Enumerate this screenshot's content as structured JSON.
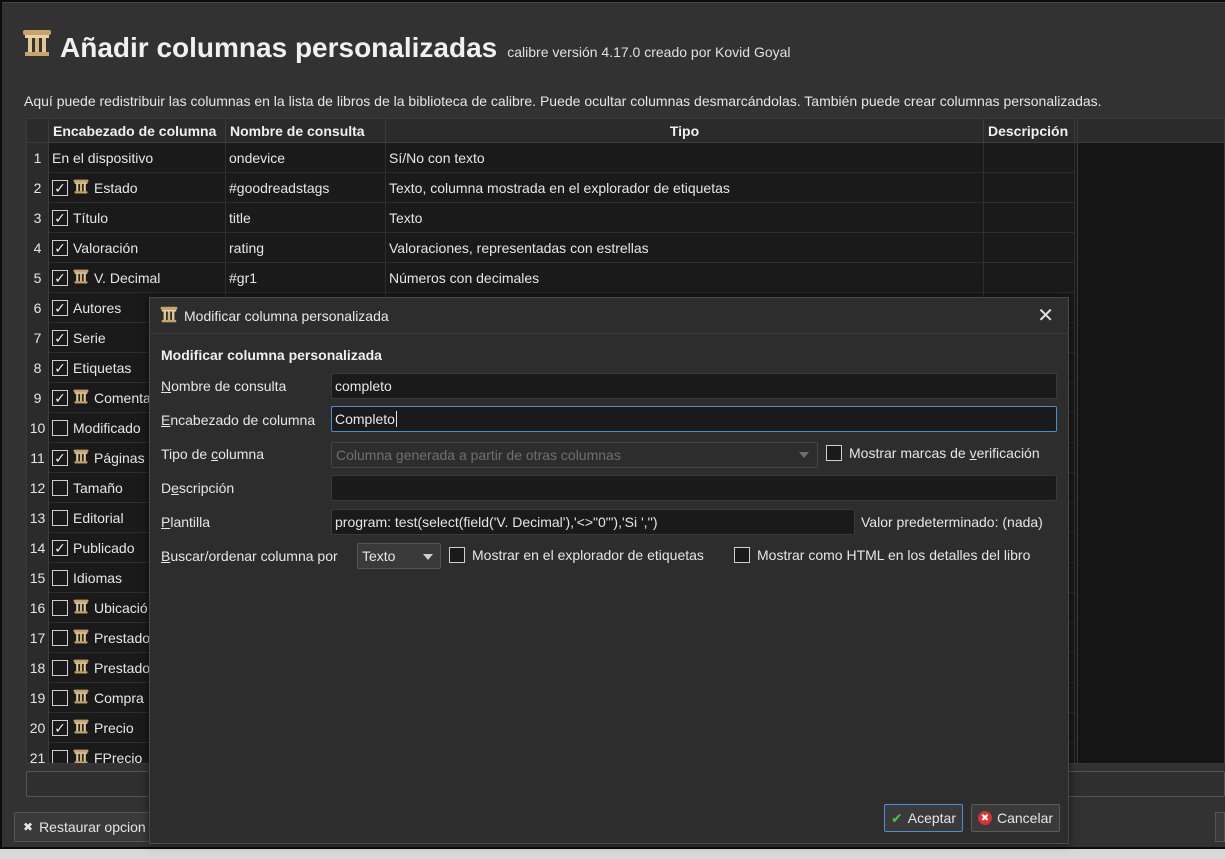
{
  "header": {
    "title": "Añadir columnas personalizadas",
    "subtitle": "calibre versión 4.17.0 creado por Kovid Goyal"
  },
  "description": "Aquí puede redistribuir las columnas en la lista de libros de la biblioteca de calibre. Puede ocultar columnas desmarcándolas. También puede crear columnas personalizadas.",
  "table": {
    "columns": [
      "Encabezado de columna",
      "Nombre de consulta",
      "Tipo",
      "Descripción"
    ],
    "rows": [
      {
        "num": "1",
        "checkbox": "none",
        "custom": false,
        "header": "En el dispositivo",
        "lookup": "ondevice",
        "type": "Sí/No con texto"
      },
      {
        "num": "2",
        "checkbox": "checked",
        "custom": true,
        "header": "Estado",
        "lookup": "#goodreadstags",
        "type": "Texto, columna mostrada en el explorador de etiquetas"
      },
      {
        "num": "3",
        "checkbox": "checked",
        "custom": false,
        "header": "Título",
        "lookup": "title",
        "type": "Texto"
      },
      {
        "num": "4",
        "checkbox": "checked",
        "custom": false,
        "header": "Valoración",
        "lookup": "rating",
        "type": "Valoraciones, representadas con estrellas"
      },
      {
        "num": "5",
        "checkbox": "checked",
        "custom": true,
        "header": "V. Decimal",
        "lookup": "#gr1",
        "type": "Números con decimales"
      },
      {
        "num": "6",
        "checkbox": "checked",
        "custom": false,
        "header": "Autores",
        "lookup": "",
        "type": ""
      },
      {
        "num": "7",
        "checkbox": "checked",
        "custom": false,
        "header": "Serie",
        "lookup": "",
        "type": ""
      },
      {
        "num": "8",
        "checkbox": "checked",
        "custom": false,
        "header": "Etiquetas",
        "lookup": "",
        "type": ""
      },
      {
        "num": "9",
        "checkbox": "checked",
        "custom": true,
        "header": "Comenta",
        "lookup": "",
        "type": ""
      },
      {
        "num": "10",
        "checkbox": "unchecked",
        "custom": false,
        "header": "Modificado",
        "lookup": "",
        "type": ""
      },
      {
        "num": "11",
        "checkbox": "checked",
        "custom": true,
        "header": "Páginas",
        "lookup": "",
        "type": ""
      },
      {
        "num": "12",
        "checkbox": "unchecked",
        "custom": false,
        "header": "Tamaño",
        "lookup": "",
        "type": ""
      },
      {
        "num": "13",
        "checkbox": "unchecked",
        "custom": false,
        "header": "Editorial",
        "lookup": "",
        "type": ""
      },
      {
        "num": "14",
        "checkbox": "checked",
        "custom": false,
        "header": "Publicado",
        "lookup": "",
        "type": ""
      },
      {
        "num": "15",
        "checkbox": "unchecked",
        "custom": false,
        "header": "Idiomas",
        "lookup": "",
        "type": ""
      },
      {
        "num": "16",
        "checkbox": "unchecked",
        "custom": true,
        "header": "Ubicació",
        "lookup": "",
        "type": ""
      },
      {
        "num": "17",
        "checkbox": "unchecked",
        "custom": true,
        "header": "Prestado",
        "lookup": "",
        "type": ""
      },
      {
        "num": "18",
        "checkbox": "unchecked",
        "custom": true,
        "header": "Prestado",
        "lookup": "",
        "type": ""
      },
      {
        "num": "19",
        "checkbox": "unchecked",
        "custom": true,
        "header": "Compra",
        "lookup": "",
        "type": ""
      },
      {
        "num": "20",
        "checkbox": "checked",
        "custom": true,
        "header": "Precio",
        "lookup": "",
        "type": ""
      },
      {
        "num": "21",
        "checkbox": "unchecked",
        "custom": true,
        "header": "FPrecio",
        "lookup": "",
        "type": ""
      }
    ]
  },
  "restore_button": "Restaurar opcion",
  "dialog": {
    "title": "Modificar columna personalizada",
    "heading": "Modificar columna personalizada",
    "lookup_label_prefix": "N",
    "lookup_label_rest": "ombre de consulta",
    "lookup_value": "completo",
    "header_label_prefix": "E",
    "header_label_rest": "ncabezado de columna",
    "header_value": "Completo",
    "type_label_a": "Tipo de ",
    "type_label_u": "c",
    "type_label_b": "olumna",
    "type_value": "Columna generada a partir de otras columnas",
    "show_checkmarks_a": "Mostrar marcas de ",
    "show_checkmarks_u": "v",
    "show_checkmarks_b": "erificación",
    "desc_label_a": "D",
    "desc_label_u": "e",
    "desc_label_b": "scripción",
    "desc_value": "",
    "template_label_u": "P",
    "template_label_rest": "lantilla",
    "template_value": "program: test(select(field('V. Decimal'),'<>\"0\"'),'Si ','')",
    "default_value_label": "Valor predeterminado: (nada)",
    "sort_label_u": "B",
    "sort_label_rest": "uscar/ordenar columna por",
    "sort_value": "Texto",
    "show_in_tag_browser": "Mostrar en el explorador de etiquetas",
    "show_as_html": "Mostrar como HTML en los detalles del libro",
    "ok_button": "Aceptar",
    "cancel_button": "Cancelar"
  },
  "colors": {
    "accent": "#4a8fd6",
    "window_bg": "#323232",
    "dialog_bg": "#2d2d2d",
    "table_bg": "#1a1a1a"
  }
}
